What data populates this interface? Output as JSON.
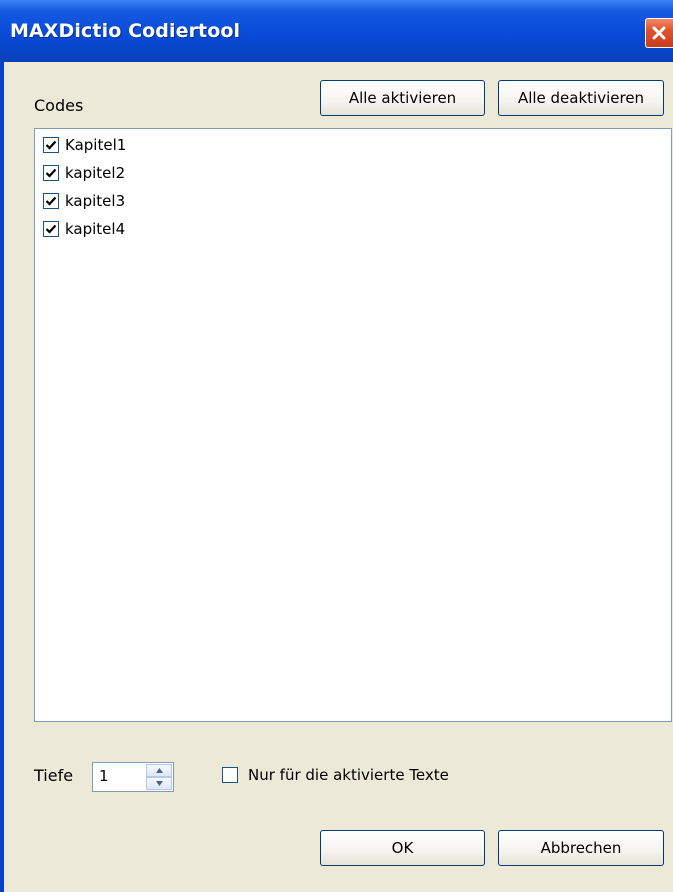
{
  "window": {
    "title": "MAXDictio Codiertool"
  },
  "codes": {
    "label": "Codes",
    "activate_all": "Alle aktivieren",
    "deactivate_all": "Alle deaktivieren",
    "items": [
      {
        "label": "Kapitel1",
        "checked": true
      },
      {
        "label": "kapitel2",
        "checked": true
      },
      {
        "label": "kapitel3",
        "checked": true
      },
      {
        "label": "kapitel4",
        "checked": true
      }
    ]
  },
  "depth": {
    "label": "Tiefe",
    "value": "1"
  },
  "only_active": {
    "label": "Nur für die aktivierte Texte",
    "checked": false
  },
  "footer": {
    "ok": "OK",
    "cancel": "Abbrechen"
  },
  "icons": {
    "close": "close-icon",
    "check": "checkmark-icon",
    "spin_up": "arrow-up-icon",
    "spin_down": "arrow-down-icon"
  }
}
